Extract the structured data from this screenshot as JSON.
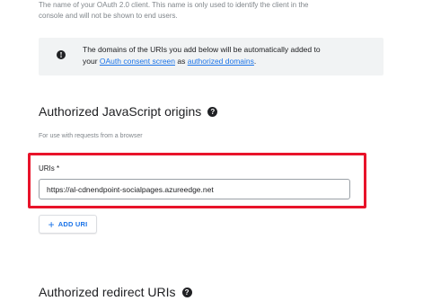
{
  "intro": {
    "line1": "The name of your OAuth 2.0 client. This name is only used to identify the client in the",
    "line2": "console and will not be shown to end users."
  },
  "info": {
    "icon": "info-icon",
    "text_before": "The domains of the URIs you add below will be automatically added to",
    "text_your": "your ",
    "link_consent": "OAuth consent screen",
    "text_as": " as ",
    "link_domains": "authorized domains",
    "text_end": "."
  },
  "js_origins": {
    "title": "Authorized JavaScript origins",
    "help_icon": "help-icon",
    "subtext": "For use with requests from a browser",
    "uris_label": "URIs *",
    "uri_value": "https://al-cdnendpoint-socialpages.azureedge.net",
    "add_button": "ADD URI",
    "add_icon": "plus-icon",
    "highlight_color": "#e8132a"
  },
  "redirect": {
    "title": "Authorized redirect URIs",
    "help_icon": "help-icon"
  },
  "colors": {
    "link": "#1a73e8",
    "info_bg": "#f1f3f4",
    "muted_text": "#80868b"
  }
}
